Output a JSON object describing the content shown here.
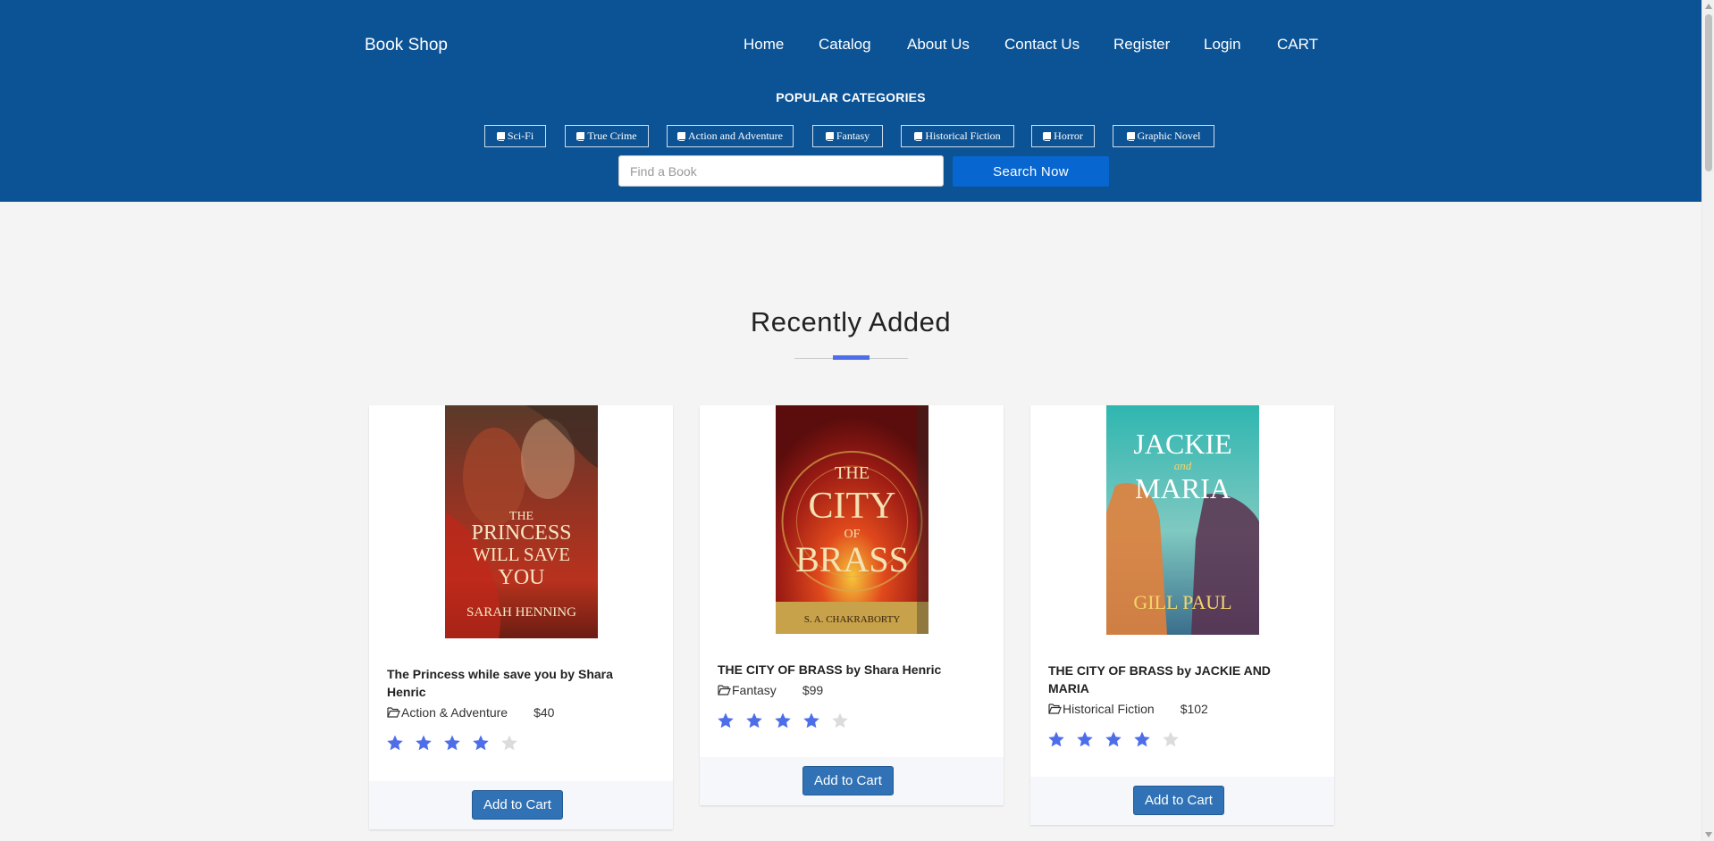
{
  "header": {
    "brand": "Book Shop",
    "nav": [
      "Home",
      "Catalog",
      "About Us",
      "Contact Us",
      "Register",
      "Login",
      "CART"
    ],
    "categories_title": "POPULAR CATEGORIES",
    "categories": [
      "Sci-Fi",
      "True Crime",
      "Action and Adventure",
      "Fantasy",
      "Historical Fiction",
      "Horror",
      "Graphic Novel"
    ],
    "search_placeholder": "Find a Book",
    "search_button": "Search Now"
  },
  "section": {
    "title": "Recently Added"
  },
  "books": [
    {
      "title": "The Princess while save you by Shara Henric",
      "category": "Action & Adventure",
      "price": "$40",
      "rating": 4,
      "rating_max": 5,
      "cover": {
        "title_lines": [
          "THE",
          "PRINCESS",
          "WILL SAVE",
          "YOU"
        ],
        "author": "SARAH HENNING"
      },
      "button": "Add to Cart"
    },
    {
      "title": "THE CITY OF BRASS by Shara Henric",
      "category": "Fantasy",
      "price": "$99",
      "rating": 4,
      "rating_max": 5,
      "cover": {
        "title_lines": [
          "THE",
          "CITY",
          "OF",
          "BRASS"
        ],
        "author": "S. A. CHAKRABORTY"
      },
      "button": "Add to Cart"
    },
    {
      "title": "THE CITY OF BRASS by JACKIE AND MARIA",
      "category": "Historical Fiction",
      "price": "$102",
      "rating": 4,
      "rating_max": 5,
      "cover": {
        "title_lines": [
          "JACKIE",
          "and",
          "MARIA"
        ],
        "author": "GILL PAUL"
      },
      "button": "Add to Cart"
    }
  ],
  "colors": {
    "header_bg": "#0c5395",
    "search_button": "#0766cf",
    "accent": "#4e6ee9",
    "star_filled": "#4e6ee9",
    "star_empty": "#dcdcdc",
    "cart_button": "#3072b5"
  },
  "icons": {
    "category_chip": "book-icon",
    "meta_category": "folder-open-icon",
    "rating": "star-icon"
  }
}
